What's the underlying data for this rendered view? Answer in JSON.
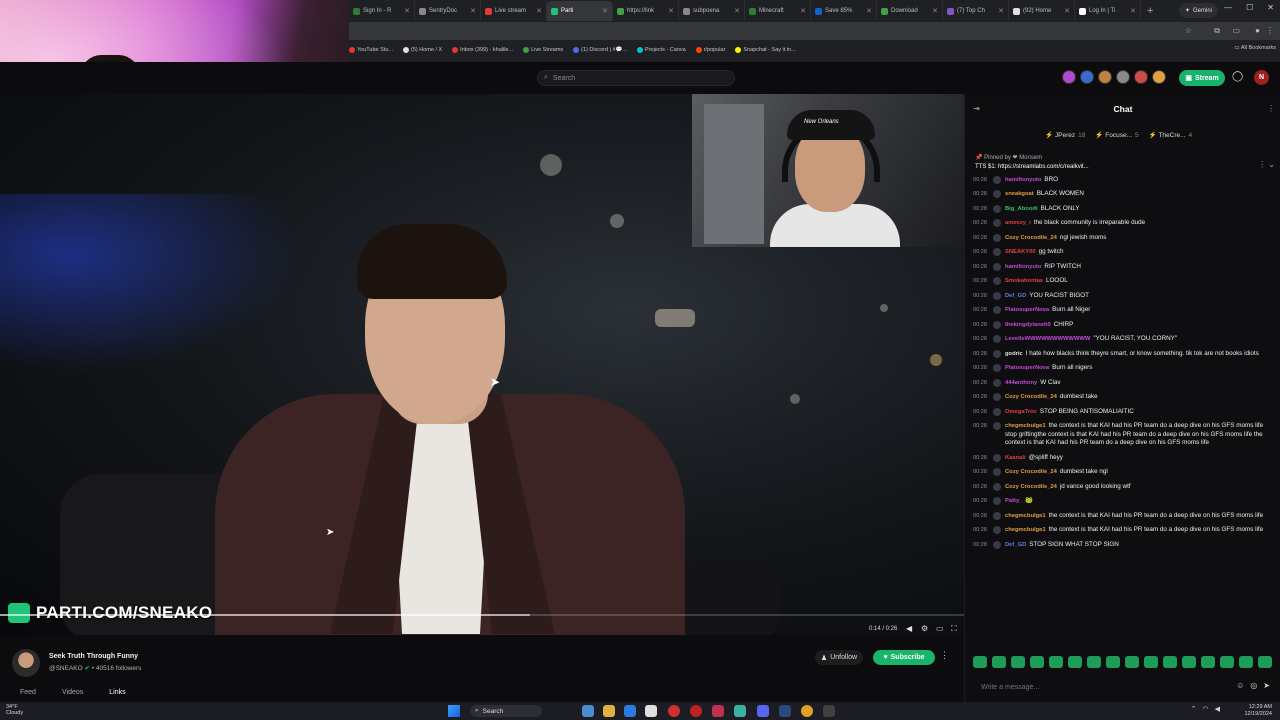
{
  "browser": {
    "tabs": [
      {
        "label": "Sign In - R",
        "color": "#2e7d32",
        "active": false
      },
      {
        "label": "SentryDoc",
        "color": "#888888",
        "active": false
      },
      {
        "label": "Live stream",
        "color": "#e53935",
        "active": false
      },
      {
        "label": "Parti",
        "color": "#21c27a",
        "active": true
      },
      {
        "label": "https://link",
        "color": "#43a047",
        "active": false
      },
      {
        "label": "subpoena",
        "color": "#888888",
        "active": false
      },
      {
        "label": "Minecraft",
        "color": "#2e7d32",
        "active": false
      },
      {
        "label": "Save 85%",
        "color": "#1565c0",
        "active": false
      },
      {
        "label": "Download",
        "color": "#43a047",
        "active": false
      },
      {
        "label": "(7) Top Ch",
        "color": "#7e57c2",
        "active": false
      },
      {
        "label": "(92) Home",
        "color": "#e0e0e0",
        "active": false
      },
      {
        "label": "Log In | Ti",
        "color": "#ffffff",
        "active": false
      }
    ],
    "new_tab": "+",
    "gemini_label": "Gemini",
    "bookmarks": [
      {
        "label": "YouTube Stu...",
        "color": "#e53935"
      },
      {
        "label": "(5) Home / X",
        "color": "#e0e0e0"
      },
      {
        "label": "Inbox (399) - khalile...",
        "color": "#e53935"
      },
      {
        "label": "Live Streams",
        "color": "#43a047"
      },
      {
        "label": "(1) Discord | #💬...",
        "color": "#5865f2"
      },
      {
        "label": "Projects - Canva",
        "color": "#00c4cc"
      },
      {
        "label": "r/popular",
        "color": "#ff4500"
      },
      {
        "label": "Snapchat - Say it in...",
        "color": "#fffc00"
      }
    ],
    "all_bookmarks": "All Bookmarks"
  },
  "site": {
    "search_placeholder": "Search",
    "stream_button": "Stream",
    "me_initial": "N",
    "avatar_colors": [
      "#b04ad0",
      "#3a6ad0",
      "#c08040",
      "#8a8a8a",
      "#d04a4a",
      "#e0a040"
    ]
  },
  "video": {
    "overlay_title": "PARTI.COM/SNEAKO",
    "time": "0:14 / 0:26",
    "progress": 0.55,
    "cam2_cap_text": "New Orleans"
  },
  "channel": {
    "title": "Seek Truth Through Funny",
    "handle": "@SNEAKO",
    "followers": "40516 followers",
    "tabs": [
      "Feed",
      "Videos",
      "Links"
    ],
    "active_tab": "Links",
    "unfollow": "Unfollow",
    "subscribe": "Subscribe"
  },
  "chat": {
    "title": "Chat",
    "leaders": [
      {
        "name": "JPerez",
        "n": "18"
      },
      {
        "name": "Focuse...",
        "n": "5"
      },
      {
        "name": "TheCre...",
        "n": "4"
      }
    ],
    "pinned_by": "Pinned by ❤ Monsem",
    "pinned_text": "TTS $1: https://streamlabs.com/c/realkvit...",
    "messages": [
      {
        "time": "00:28",
        "user": "hamiltonyuto",
        "color": "#c44ad6",
        "text": "BRO"
      },
      {
        "time": "00:28",
        "user": "sneakgoat",
        "color": "#e0a040",
        "text": "BLACK WOMEN"
      },
      {
        "time": "00:28",
        "user": "Big_Aboodi",
        "color": "#3fbf6a",
        "text": "BLACK ONLY"
      },
      {
        "time": "00:28",
        "user": "ameezy_i",
        "color": "#e04040",
        "text": "the black community is irreparable dude"
      },
      {
        "time": "00:28",
        "user": "Cozy Crocodile_24",
        "color": "#e0a040",
        "text": "ngl jewish moms"
      },
      {
        "time": "00:28",
        "user": "SNEAKY00",
        "color": "#e04040",
        "text": "gg twitch"
      },
      {
        "time": "00:28",
        "user": "hamiltonyuto",
        "color": "#c44ad6",
        "text": "RIP TWITCH"
      },
      {
        "time": "00:28",
        "user": "Smokahontas",
        "color": "#e04040",
        "text": "LOOOL"
      },
      {
        "time": "00:28",
        "user": "Def_GD",
        "color": "#6a7ae0",
        "text": "YOU RACIST BIGOT"
      },
      {
        "time": "00:28",
        "user": "PlatosuperNova",
        "color": "#c44ad6",
        "text": "Burn all Niger"
      },
      {
        "time": "00:28",
        "user": "thekingdylansh0",
        "color": "#c44ad6",
        "text": "CHIRP"
      },
      {
        "time": "00:28",
        "user": "LevelleWWWWWWWWWWWW",
        "color": "#c44ad6",
        "text": "\"YOU RACIST, YOU CORNY\""
      },
      {
        "time": "00:28",
        "user": "godric",
        "color": "#e0e0e0",
        "text": "I hate how blacks think theyre smart, or know something. tik tok are not books idiots"
      },
      {
        "time": "00:28",
        "user": "PlatosuperNova",
        "color": "#c44ad6",
        "text": "Burn all nigers"
      },
      {
        "time": "00:28",
        "user": "444anthony",
        "color": "#c44ad6",
        "text": "W Clav"
      },
      {
        "time": "00:28",
        "user": "Cozy Crocodile_24",
        "color": "#e0a040",
        "text": "dumbest take"
      },
      {
        "time": "00:28",
        "user": "OmegaTroc",
        "color": "#e04040",
        "text": "STOP BEING ANTISOMALIAITIC"
      },
      {
        "time": "00:28",
        "user": "chegmcbulge1",
        "color": "#e0a040",
        "text": "the context is that KAI had his PR team do a deep dive on his GFS moms life stop griftingthe context is that KAI had his PR team do a deep dive on his GFS moms life the context is that KAI had his PR team do a deep dive on his GFS moms life"
      },
      {
        "time": "00:28",
        "user": "Kaanali",
        "color": "#e04040",
        "text": "@spliff heyy"
      },
      {
        "time": "00:28",
        "user": "Cozy Crocodile_24",
        "color": "#e0a040",
        "text": "dumbest take ngl"
      },
      {
        "time": "00:28",
        "user": "Cozy Crocodile_24",
        "color": "#e0a040",
        "text": "jd vance good looking wtf"
      },
      {
        "time": "00:28",
        "user": "Patty_",
        "color": "#c44ad6",
        "text": "🐸"
      },
      {
        "time": "00:28",
        "user": "chegmcbulge1",
        "color": "#e0a040",
        "text": "the context is that KAI had his PR team do a deep dive on his GFS moms life"
      },
      {
        "time": "00:28",
        "user": "chegmcbulge1",
        "color": "#e0a040",
        "text": "the context is that KAI had his PR team do a deep dive on his GFS moms life"
      },
      {
        "time": "00:28",
        "user": "Def_GD",
        "color": "#6a7ae0",
        "text": "STOP SIGN WHAT STOP SIGN"
      }
    ],
    "input_placeholder": "Write a message...",
    "emote_count": 16
  },
  "taskbar": {
    "weather_temp": "34°F",
    "weather_desc": "Cloudy",
    "search": "Search",
    "time": "12:29 AM",
    "date": "12/19/2024"
  }
}
